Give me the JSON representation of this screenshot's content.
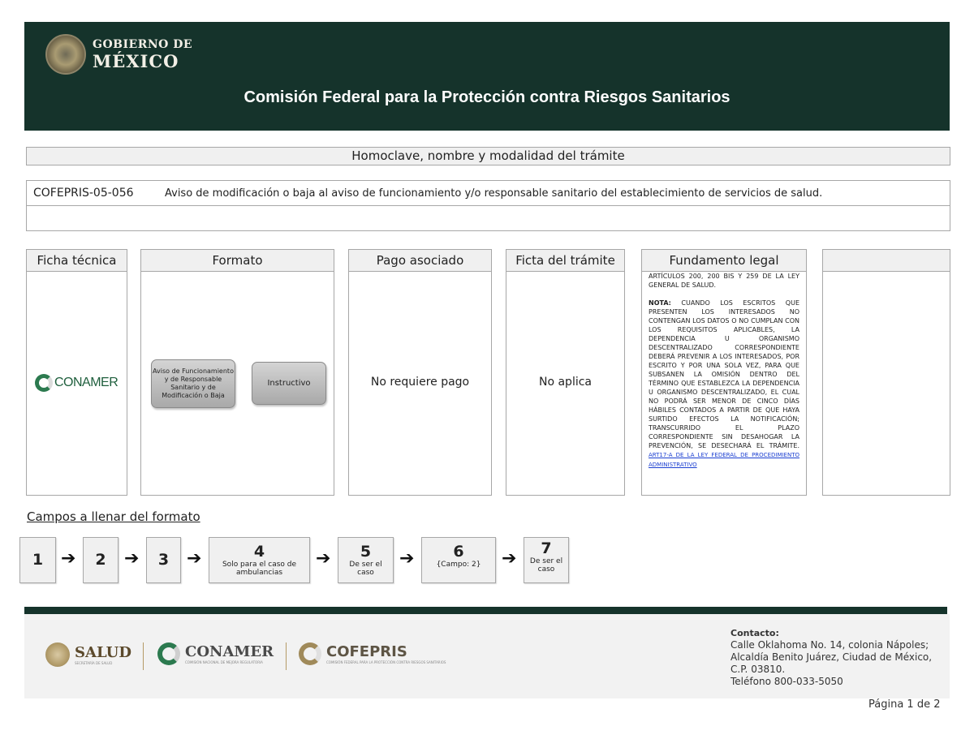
{
  "header": {
    "logo_line1": "GOBIERNO DE",
    "logo_line2": "MÉXICO",
    "title": "Comisión Federal para la Protección contra Riesgos Sanitarios"
  },
  "section": {
    "homoclave_title": "Homoclave, nombre y modalidad del trámite",
    "code": "COFEPRIS-05-056",
    "name": "Aviso de modificación o baja al aviso de funcionamiento y/o responsable sanitario  del establecimiento de servicios de salud."
  },
  "columns": {
    "ficha": {
      "title": "Ficha técnica",
      "logo_text": "CONAMER"
    },
    "formato": {
      "title": "Formato",
      "button1": "Aviso de Funcionamiento y de Responsable Sanitario y de Modificación o Baja",
      "button2": "Instructivo"
    },
    "pago": {
      "title": "Pago asociado",
      "value": "No requiere pago"
    },
    "ficta": {
      "title": "Ficta del trámite",
      "value": "No aplica"
    },
    "fundamento": {
      "title": "Fundamento legal",
      "text1": "ARTÍCULOS 200, 200 BIS Y 259 DE LA LEY GENERAL DE SALUD.",
      "nota_label": "NOTA:",
      "nota_text": " CUANDO LOS ESCRITOS QUE PRESENTEN LOS INTERESADOS NO CONTENGAN LOS DATOS O NO CUMPLAN CON LOS REQUISITOS APLICABLES, LA DEPENDENCIA U ORGANISMO DESCENTRALIZADO CORRESPONDIENTE DEBERÁ PREVENIR A LOS INTERESADOS, POR ESCRITO Y POR UNA SOLA VEZ, PARA QUE SUBSANEN LA OMISIÓN DENTRO DEL TÉRMINO QUE ESTABLEZCA LA DEPENDENCIA U ORGANISMO DESCENTRALIZADO, EL CUAL NO PODRÁ SER MENOR DE CINCO DÍAS HÁBILES CONTADOS A PARTIR DE QUE HAYA SURTIDO EFECTOS LA NOTIFICACIÓN; TRANSCURRIDO EL PLAZO CORRESPONDIENTE SIN DESAHOGAR LA PREVENCIÓN, SE DESECHARÁ EL TRÁMITE. ",
      "link": "ART17-A DE LA LEY FEDERAL DE PROCEDIMIENTO ADMINISTRATIVO"
    }
  },
  "campos": {
    "title": "Campos a llenar del formato",
    "steps": [
      {
        "num": "1",
        "sub": ""
      },
      {
        "num": "2",
        "sub": ""
      },
      {
        "num": "3",
        "sub": ""
      },
      {
        "num": "4",
        "sub": "Solo para el caso de ambulancias"
      },
      {
        "num": "5",
        "sub": "De ser el caso"
      },
      {
        "num": "6",
        "sub": "{Campo: 2}"
      },
      {
        "num": "7",
        "sub": "De ser el caso"
      }
    ],
    "arrow": "➔"
  },
  "footer": {
    "salud": "SALUD",
    "salud_sub": "SECRETARÍA DE SALUD",
    "conamer": "CONAMER",
    "conamer_sub": "COMISIÓN NACIONAL DE MEJORA REGULATORIA",
    "cofepris": "COFEPRIS",
    "cofepris_sub": "COMISIÓN FEDERAL PARA LA PROTECCIÓN CONTRA RIESGOS SANITARIOS",
    "contact_title": "Contacto:",
    "contact_line1": "Calle Oklahoma No. 14, colonia Nápoles;",
    "contact_line2": "Alcaldía Benito Juárez, Ciudad de México,",
    "contact_line3": "C.P. 03810.",
    "contact_line4": "Teléfono 800-033-5050"
  },
  "page": "Página 1 de 2",
  "colors": {
    "header_bg": "#15332b",
    "link": "#1b3fd1",
    "conamer_green": "#2c7a4f"
  }
}
